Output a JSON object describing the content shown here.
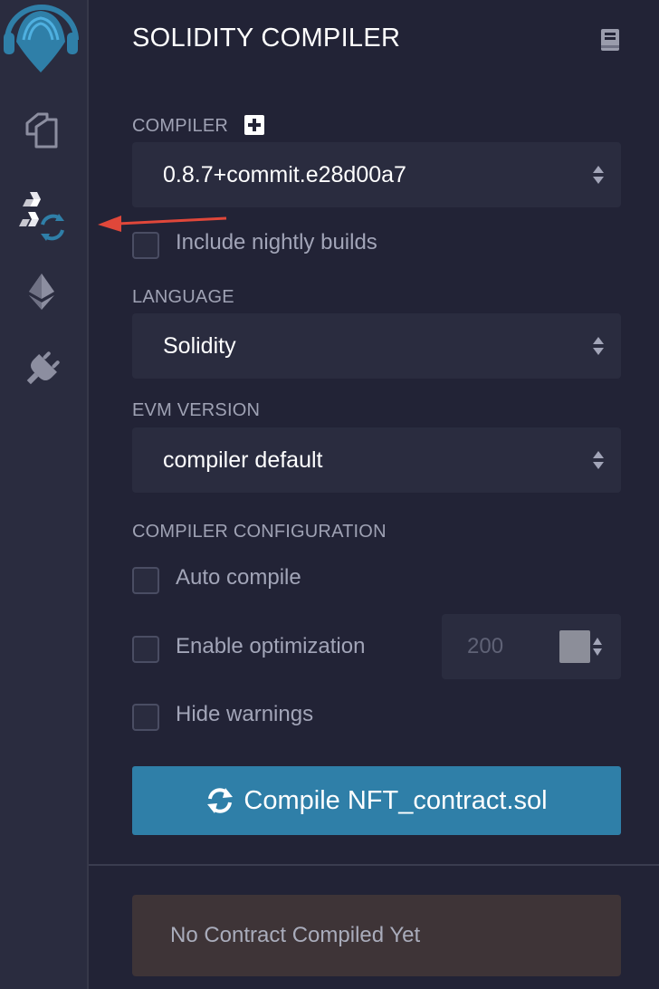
{
  "panel": {
    "title": "SOLIDITY COMPILER",
    "doc_icon": "book-icon"
  },
  "sidebar": {
    "items": [
      {
        "name": "remix-logo",
        "icon": "remix-logo-icon"
      },
      {
        "name": "file-explorer",
        "icon": "files-icon"
      },
      {
        "name": "solidity-compiler",
        "icon": "solidity-compile-icon",
        "active": true
      },
      {
        "name": "deploy-run",
        "icon": "ethereum-icon"
      },
      {
        "name": "plugin-manager",
        "icon": "plug-icon"
      }
    ]
  },
  "compiler": {
    "label": "COMPILER",
    "add_icon": "plus-square-icon",
    "selected": "0.8.7+commit.e28d00a7",
    "nightly_label": "Include nightly builds",
    "nightly_checked": false
  },
  "language": {
    "label": "LANGUAGE",
    "selected": "Solidity"
  },
  "evm": {
    "label": "EVM VERSION",
    "selected": "compiler default"
  },
  "config": {
    "label": "COMPILER CONFIGURATION",
    "auto_compile_label": "Auto compile",
    "auto_compile_checked": false,
    "optimization_label": "Enable optimization",
    "optimization_checked": false,
    "runs_value": "200",
    "hide_warnings_label": "Hide warnings",
    "hide_warnings_checked": false
  },
  "compile_button": {
    "icon": "refresh-icon",
    "label": "Compile NFT_contract.sol"
  },
  "status": {
    "text": "No Contract Compiled Yet"
  },
  "colors": {
    "background": "#222336",
    "sidebar": "#2a2c3f",
    "accent": "#2f7fa8",
    "status_bg": "#3e3437",
    "annotation_arrow": "#e0473a"
  }
}
